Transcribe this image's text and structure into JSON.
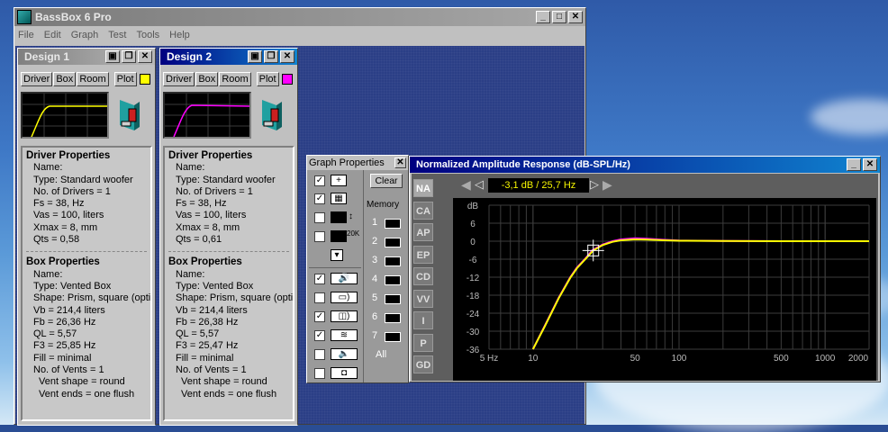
{
  "app": {
    "title": "BassBox 6 Pro",
    "menu": [
      "File",
      "Edit",
      "Graph",
      "Test",
      "Tools",
      "Help"
    ]
  },
  "colors": {
    "design1_curve": "#ffff00",
    "design2_curve": "#ff00ff",
    "titlebar_active": "#000080"
  },
  "designs": [
    {
      "title": "Design 1",
      "buttons": {
        "driver": "Driver",
        "box": "Box",
        "room": "Room",
        "plot": "Plot"
      },
      "plot_color": "#ffff00",
      "driver_heading": "Driver Properties",
      "driver_lines": [
        "Name:",
        "Type: Standard woofer",
        "No. of Drivers = 1",
        "Fs = 38, Hz",
        "Vas = 100, liters",
        "Xmax = 8, mm",
        "Qts = 0,58"
      ],
      "box_heading": "Box Properties",
      "box_lines": [
        "Name:",
        "Type: Vented Box",
        "Shape: Prism, square (optimu",
        "Vb = 214,4 liters",
        "Fb = 26,36 Hz",
        "QL = 5,57",
        "F3 = 25,85 Hz",
        "Fill = minimal",
        "No. of Vents = 1"
      ],
      "vent_lines": [
        "Vent shape = round",
        "Vent ends = one flush"
      ]
    },
    {
      "title": "Design 2",
      "buttons": {
        "driver": "Driver",
        "box": "Box",
        "room": "Room",
        "plot": "Plot"
      },
      "plot_color": "#ff00ff",
      "driver_heading": "Driver Properties",
      "driver_lines": [
        "Name:",
        "Type: Standard woofer",
        "No. of Drivers = 1",
        "Fs = 38, Hz",
        "Vas = 100, liters",
        "Xmax = 8, mm",
        "Qts = 0,61"
      ],
      "box_heading": "Box Properties",
      "box_lines": [
        "Name:",
        "Type: Vented Box",
        "Shape: Prism, square (optimu",
        "Vb = 214,4 liters",
        "Fb = 26,38 Hz",
        "QL = 5,57",
        "F3 = 25,47 Hz",
        "Fill = minimal",
        "No. of Vents = 1"
      ],
      "vent_lines": [
        "Vent shape = round",
        "Vent ends = one flush"
      ]
    }
  ],
  "graph_properties": {
    "title": "Graph Properties",
    "clear_label": "Clear",
    "memory_label": "Memory",
    "memory_slots": [
      "1",
      "2",
      "3",
      "4",
      "5",
      "6",
      "7"
    ],
    "all_label": "All",
    "icon_20k": "20K",
    "checkboxes": [
      true,
      true,
      false,
      false,
      true,
      false,
      true,
      true,
      false,
      false
    ]
  },
  "graph": {
    "title": "Normalized Amplitude Response (dB-SPL/Hz)",
    "cursor_readout": "-3,1 dB / 25,7 Hz",
    "tabs": [
      "NA",
      "CA",
      "AP",
      "EP",
      "CD",
      "VV",
      "I",
      "P",
      "GD"
    ],
    "selected_tab": "NA"
  },
  "chart_data": {
    "type": "line",
    "title": "Normalized Amplitude Response (dB-SPL/Hz)",
    "ylabel": "dB",
    "xlabel": "",
    "x_scale": "log",
    "xlim": [
      5,
      2000
    ],
    "ylim": [
      -36,
      12
    ],
    "x_tick_labels": [
      "5 Hz",
      "10",
      "50",
      "100",
      "500",
      "1000",
      "2000"
    ],
    "x_tick_values": [
      5,
      10,
      50,
      100,
      500,
      1000,
      2000
    ],
    "y_tick_labels": [
      "dB",
      "6",
      "0",
      "-6",
      "-12",
      "-18",
      "-24",
      "-30",
      "-36"
    ],
    "y_tick_values": [
      6,
      0,
      -6,
      -12,
      -18,
      -24,
      -30,
      -36
    ],
    "grid": true,
    "series": [
      {
        "color": "#ffff00",
        "x": [
          10,
          12,
          15,
          18,
          20,
          23,
          25.85,
          30,
          35,
          40,
          50,
          60,
          80,
          100,
          200,
          500,
          1000,
          2000
        ],
        "y": [
          -36,
          -28.5,
          -19,
          -12.2,
          -9,
          -5.8,
          -3.1,
          -1.3,
          -0.2,
          0.3,
          0.6,
          0.5,
          0.3,
          0.15,
          0.05,
          0,
          0,
          0
        ]
      },
      {
        "color": "#ff00ff",
        "x": [
          10,
          12,
          15,
          18,
          20,
          23,
          25.47,
          30,
          35,
          40,
          50,
          60,
          80,
          100,
          200,
          500
        ],
        "y": [
          -36,
          -28.3,
          -18.8,
          -12,
          -8.8,
          -5.6,
          -3.0,
          -1.1,
          0,
          0.6,
          0.95,
          0.8,
          0.45,
          0.2,
          0.05,
          0
        ]
      }
    ]
  }
}
